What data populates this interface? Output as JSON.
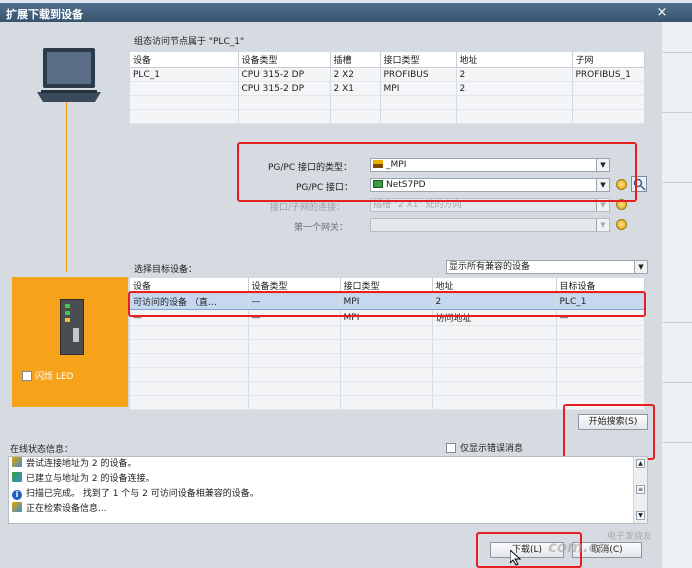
{
  "window": {
    "title": "扩展下载到设备",
    "close_glyph": "×"
  },
  "access_node": {
    "label": "组态访问节点属于 \"PLC_1\"",
    "columns": [
      "设备",
      "设备类型",
      "插槽",
      "接口类型",
      "地址",
      "子网"
    ],
    "rows": [
      [
        "PLC_1",
        "CPU 315-2 DP",
        "2 X2",
        "PROFIBUS",
        "2",
        "PROFIBUS_1"
      ],
      [
        "",
        "CPU 315-2 DP",
        "2 X1",
        "MPI",
        "2",
        ""
      ],
      [
        "",
        "",
        "",
        "",
        "",
        ""
      ],
      [
        "",
        "",
        "",
        "",
        "",
        ""
      ]
    ]
  },
  "pgpc": {
    "interface_type_label": "PG/PC 接口的类型：",
    "interface_type_value": "_MPI",
    "interface_label": "PG/PC 接口：",
    "interface_value": "NetS7PD",
    "subnet_conn_label": "接口/子网的连接：",
    "subnet_conn_value": "插槽 \"2 X1\" 处的方向",
    "first_gateway_label": "第一个网关：",
    "first_gateway_value": ""
  },
  "target": {
    "label": "选择目标设备：",
    "filter_value": "显示所有兼容的设备",
    "columns": [
      "设备",
      "设备类型",
      "接口类型",
      "地址",
      "目标设备"
    ],
    "rows": [
      [
        "可访问的设备 （直…",
        "—",
        "MPI",
        "2",
        "PLC_1"
      ],
      [
        "—",
        "—",
        "MPI",
        "访问地址",
        "—"
      ],
      [
        "",
        "",
        "",
        "",
        ""
      ],
      [
        "",
        "",
        "",
        "",
        ""
      ],
      [
        "",
        "",
        "",
        "",
        ""
      ],
      [
        "",
        "",
        "",
        "",
        ""
      ]
    ]
  },
  "left_panel": {
    "blink_led_label": "闪烁 LED"
  },
  "buttons": {
    "start_search": "开始搜索(S)",
    "download": "下载(L)",
    "cancel": "取消(C)"
  },
  "status": {
    "label": "在线状态信息：",
    "errors_only_label": "仅显示错误消息",
    "messages": [
      {
        "text": "尝试连接地址为 2 的设备。",
        "icon": "connect-icon"
      },
      {
        "text": "已建立与地址为 2 的设备连接。",
        "icon": "connected-icon"
      },
      {
        "text": "扫描已完成。 找到了 1 个与 2 可访问设备相兼容的设备。",
        "icon": "info-icon"
      },
      {
        "text": "正在检索设备信息...",
        "icon": "connect-icon"
      }
    ]
  },
  "watermark": {
    "text": "com.cn",
    "cn": "电子发烧友"
  },
  "colors": {
    "titlebar": "#3f5f7c",
    "highlight_box": "#e62020",
    "device_panel": "#f7a21b",
    "selected_row": "#c6d8ef"
  }
}
